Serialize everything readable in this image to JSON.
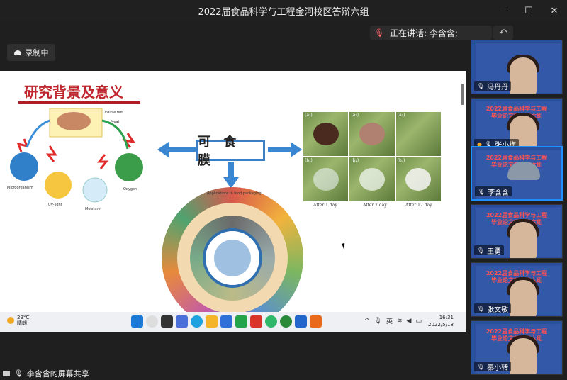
{
  "window": {
    "title": "2022届食品科学与工程金河校区答辩六组"
  },
  "speaking": {
    "label": "正在讲话: 李含含;"
  },
  "recording": {
    "label": "录制中"
  },
  "slide": {
    "title": "研究背景及意义",
    "center_label": "可 食 膜",
    "left_fig_labels": [
      "Edible film",
      "Meat",
      "Microorganism",
      "UV-light",
      "Moisture",
      "Oxygen"
    ],
    "photo_tags": [
      "(a₁)",
      "(a₂)",
      "(a₃)",
      "(b₁)",
      "(b₂)",
      "(b₃)"
    ],
    "photo_captions": [
      "After 1 day",
      "After 7 day",
      "After 17 day"
    ],
    "wheel_label": "Applications in food packaging"
  },
  "taskbar": {
    "temp": "29°C",
    "weather": "晴朗",
    "lang": "英",
    "time": "16:31",
    "date": "2022/5/18"
  },
  "footer": {
    "label": "李含含的屏幕共享"
  },
  "participants": [
    {
      "name": "冯丹丹"
    },
    {
      "name": "张小梅"
    },
    {
      "name": "李含含"
    },
    {
      "name": "王勇"
    },
    {
      "name": "张文敏"
    },
    {
      "name": "秦小转"
    }
  ],
  "participant_slide_text": [
    "2022届食品科学与工程",
    "毕业论文答辩第六组"
  ],
  "colors": {
    "accent": "#1e90ff",
    "slide_title": "#c0262e",
    "arrow": "#3b86d0"
  }
}
